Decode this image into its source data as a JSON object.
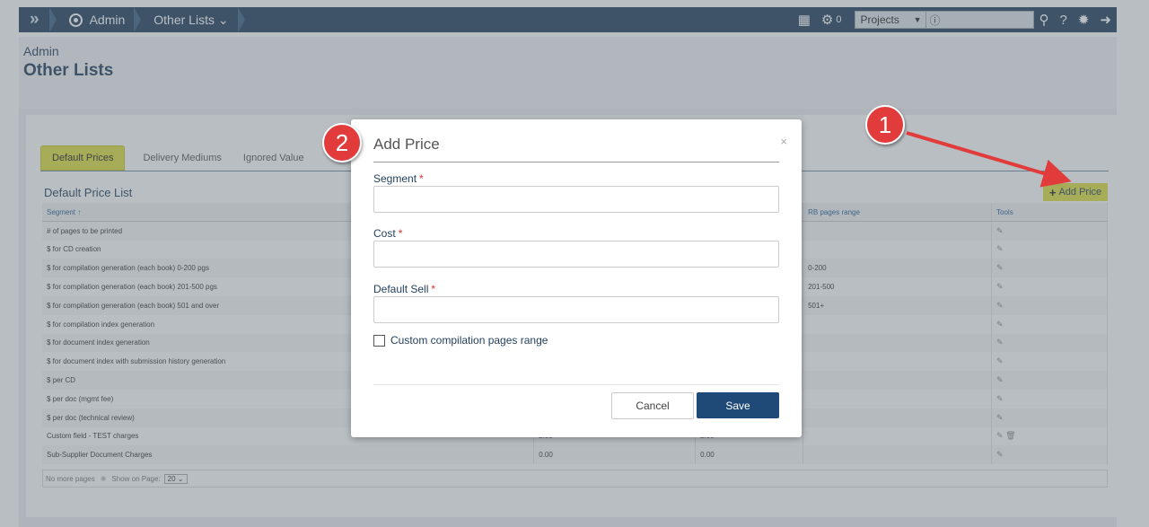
{
  "nav": {
    "logo": "»",
    "crumbs": [
      "Admin",
      "Other Lists"
    ],
    "crumb_caret": "⌄",
    "notif_count": "0",
    "projects_label": "Projects",
    "search_info": "ⓘ"
  },
  "header": {
    "section": "Admin",
    "title": "Other Lists"
  },
  "tabs": [
    "Default Prices",
    "Delivery Mediums",
    "Ignored Value"
  ],
  "list": {
    "title": "Default Price List",
    "add_button": "Add Price",
    "columns": [
      "Segment ↑",
      "",
      "",
      "RB pages range",
      "Tools"
    ],
    "rows": [
      {
        "segment": "# of pages to be printed",
        "cost": "",
        "sell": "",
        "range": "",
        "bold": true,
        "delete": false
      },
      {
        "segment": "$ for CD creation",
        "cost": "",
        "sell": "",
        "range": "",
        "bold": true,
        "delete": false
      },
      {
        "segment": "$ for compilation generation (each book) 0-200 pgs",
        "cost": "",
        "sell": "",
        "range": "0-200",
        "bold": true,
        "delete": false
      },
      {
        "segment": "$ for compilation generation (each book) 201-500 pgs",
        "cost": "",
        "sell": "",
        "range": "201-500",
        "bold": true,
        "delete": false
      },
      {
        "segment": "$ for compilation generation (each book) 501 and over",
        "cost": "",
        "sell": "",
        "range": "501+",
        "bold": true,
        "delete": false
      },
      {
        "segment": "$ for compilation index generation",
        "cost": "",
        "sell": "",
        "range": "",
        "bold": true,
        "delete": false
      },
      {
        "segment": "$ for document index generation",
        "cost": "",
        "sell": "",
        "range": "",
        "bold": true,
        "delete": false
      },
      {
        "segment": "$ for document index with submission history generation",
        "cost": "",
        "sell": "",
        "range": "",
        "bold": true,
        "delete": false
      },
      {
        "segment": "$ per CD",
        "cost": "",
        "sell": "",
        "range": "",
        "bold": true,
        "delete": false
      },
      {
        "segment": "$ per doc (mgmt fee)",
        "cost": "",
        "sell": "",
        "range": "",
        "bold": true,
        "delete": false
      },
      {
        "segment": "$ per doc (technical review)",
        "cost": "",
        "sell": "",
        "range": "",
        "bold": true,
        "delete": false
      },
      {
        "segment": "Custom field - TEST charges",
        "cost": "2.00",
        "sell": "2.00",
        "range": "",
        "bold": false,
        "delete": true
      },
      {
        "segment": "Sub-Supplier Document Charges",
        "cost": "0.00",
        "sell": "0.00",
        "range": "",
        "bold": true,
        "delete": false
      }
    ],
    "footer": {
      "no_more": "No more pages",
      "show_label": "Show on Page:",
      "page_size": "20 ⌄"
    }
  },
  "modal": {
    "title": "Add Price",
    "close": "×",
    "fields": [
      {
        "label": "Segment",
        "required": "*"
      },
      {
        "label": "Cost",
        "required": "*"
      },
      {
        "label": "Default Sell",
        "required": "*"
      }
    ],
    "checkbox_label": "Custom compilation pages range",
    "cancel": "Cancel",
    "save": "Save"
  },
  "annotations": [
    "1",
    "2"
  ],
  "colors": {
    "nav": "#1f3d5c",
    "tab_active": "#dede40",
    "save": "#1f4a78",
    "bubble": "#e23b3b",
    "arrow": "#e23b3b"
  },
  "icons": {
    "edit": "pencil-icon",
    "delete": "trash-icon",
    "settings": "gear-icon",
    "help": "question-icon",
    "logout": "logout-icon",
    "search": "search-icon"
  }
}
